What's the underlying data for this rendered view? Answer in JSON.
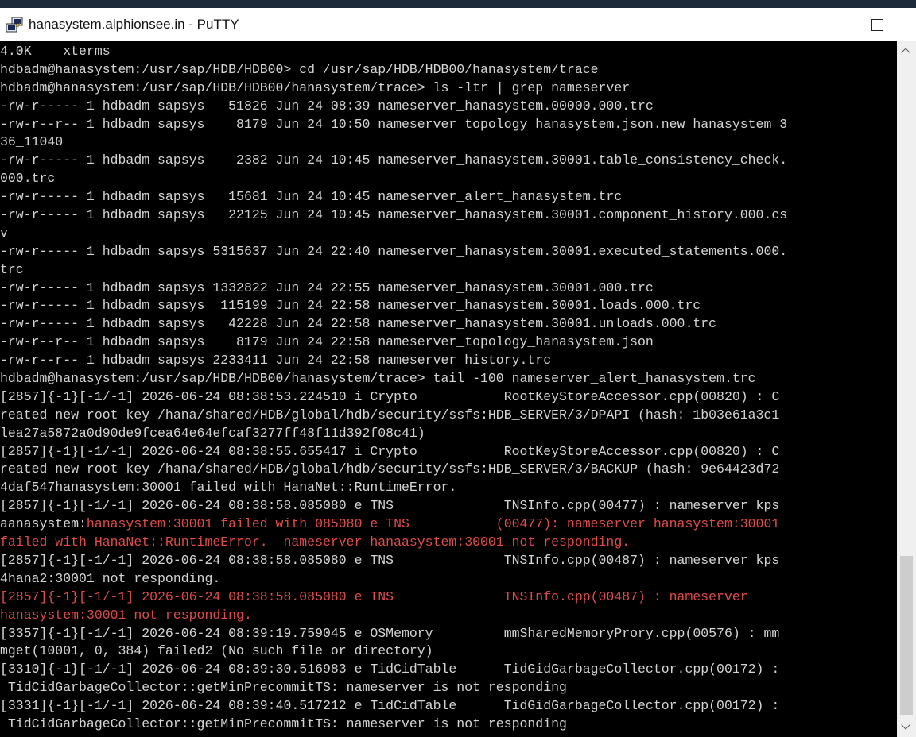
{
  "window": {
    "title": "hanasystem.alphionsee.in - PuTTY"
  },
  "icons": {
    "app": "putty-icon",
    "minimize": "minimize-icon",
    "maximize": "maximize-icon",
    "scroll_up": "scroll-up-arrow-icon",
    "scroll_down": "scroll-down-arrow-icon"
  },
  "colors": {
    "terminal_bg": "#000000",
    "terminal_fg": "#d4d4d4",
    "error_text": "#e04a48"
  },
  "terminal": {
    "lines": [
      {
        "text": "4.0K    xterms"
      },
      {
        "text": "hdbadm@hanasystem:/usr/sap/HDB/HDB00> cd /usr/sap/HDB/HDB00/hanasystem/trace"
      },
      {
        "text": "hdbadm@hanasystem:/usr/sap/HDB/HDB00/hanasystem/trace> ls -ltr | grep nameserver"
      },
      {
        "text": "-rw-r----- 1 hdbadm sapsys   51826 Jun 24 08:39 nameserver_hanasystem.00000.000.trc"
      },
      {
        "text": "-rw-r--r-- 1 hdbadm sapsys    8179 Jun 24 10:50 nameserver_topology_hanasystem.json.new_hanasystem_3"
      },
      {
        "text": "36_11040"
      },
      {
        "text": "-rw-r----- 1 hdbadm sapsys    2382 Jun 24 10:45 nameserver_hanasystem.30001.table_consistency_check."
      },
      {
        "text": "000.trc"
      },
      {
        "text": "-rw-r----- 1 hdbadm sapsys   15681 Jun 24 10:45 nameserver_alert_hanasystem.trc"
      },
      {
        "text": "-rw-r----- 1 hdbadm sapsys   22125 Jun 24 10:45 nameserver_hanasystem.30001.component_history.000.cs"
      },
      {
        "text": "v"
      },
      {
        "text": "-rw-r----- 1 hdbadm sapsys 5315637 Jun 24 22:40 nameserver_hanasystem.30001.executed_statements.000."
      },
      {
        "text": "trc"
      },
      {
        "text": "-rw-r----- 1 hdbadm sapsys 1332822 Jun 24 22:55 nameserver_hanasystem.30001.000.trc"
      },
      {
        "text": "-rw-r----- 1 hdbadm sapsys  115199 Jun 24 22:58 nameserver_hanasystem.30001.loads.000.trc"
      },
      {
        "text": "-rw-r----- 1 hdbadm sapsys   42228 Jun 24 22:58 nameserver_hanasystem.30001.unloads.000.trc"
      },
      {
        "text": "-rw-r--r-- 1 hdbadm sapsys    8179 Jun 24 22:58 nameserver_topology_hanasystem.json"
      },
      {
        "text": "-rw-r--r-- 1 hdbadm sapsys 2233411 Jun 24 22:58 nameserver_history.trc"
      },
      {
        "text": "hdbadm@hanasystem:/usr/sap/HDB/HDB00/hanasystem/trace> tail -100 nameserver_alert_hanasystem.trc"
      },
      {
        "text": "[2857]{-1}[-1/-1] 2026-06-24 08:38:53.224510 i Crypto           RootKeyStoreAccessor.cpp(00820) : C"
      },
      {
        "text": "reated new root key /hana/shared/HDB/global/hdb/security/ssfs:HDB_SERVER/3/DPAPI (hash: 1b03e61a3c1"
      },
      {
        "text": "lea27a5872a0d90de9fcea64e64efcaf3277ff48f11d392f08c41)"
      },
      {
        "text": "[2857]{-1}[-1/-1] 2026-06-24 08:38:55.655417 i Crypto           RootKeyStoreAccessor.cpp(00820) : C"
      },
      {
        "text": "reated new root key /hana/shared/HDB/global/hdb/security/ssfs:HDB_SERVER/3/BACKUP (hash: 9e64423d72"
      },
      {
        "text": "4daf547hanasystem:30001 failed with HanaNet::RuntimeError."
      },
      {
        "text": "[2857]{-1}[-1/-1] 2026-06-24 08:38:58.085080 e TNS              TNSInfo.cpp(00477) : nameserver kps"
      },
      {
        "text": "aanasystem:",
        "red": "hanasystem:30001 failed with 085080 e TNS           (00477): nameserver hanasystem:30001"
      },
      {
        "text": "",
        "red": "failed with HanaNet::RuntimeError.  nameserver hanaasystem:30001 not responding."
      },
      {
        "text": "[2857]{-1}[-1/-1] 2026-06-24 08:38:58.085080 e TNS              TNSInfo.cpp(00487) : nameserver kps"
      },
      {
        "text": "4hana2:30001 not responding."
      },
      {
        "text": "",
        "red": "[2857]{-1}[-1/-1] 2026-06-24 08:38:58.085080 e TNS              TNSInfo.cpp(00487) : nameserver"
      },
      {
        "text": "",
        "red": "hanasystem:30001 not responding."
      },
      {
        "text": "[3357]{-1}[-1/-1] 2026-06-24 08:39:19.759045 e OSMemory         mmSharedMemoryProry.cpp(00576) : mm"
      },
      {
        "text": "mget(10001, 0, 384) failed2 (No such file or directory)"
      },
      {
        "text": "[3310]{-1}[-1/-1] 2026-06-24 08:39:30.516983 e TidCidTable      TidGidGarbageCollector.cpp(00172) :"
      },
      {
        "text": " TidCidGarbageCollector::getMinPrecommitTS: nameserver is not responding"
      },
      {
        "text": "[3331]{-1}[-1/-1] 2026-06-24 08:39:40.517212 e TidCidTable      TidGidGarbageCollector.cpp(00172) :"
      },
      {
        "text": " TidCidGarbageCollector::getMinPrecommitTS: nameserver is not responding"
      }
    ]
  }
}
